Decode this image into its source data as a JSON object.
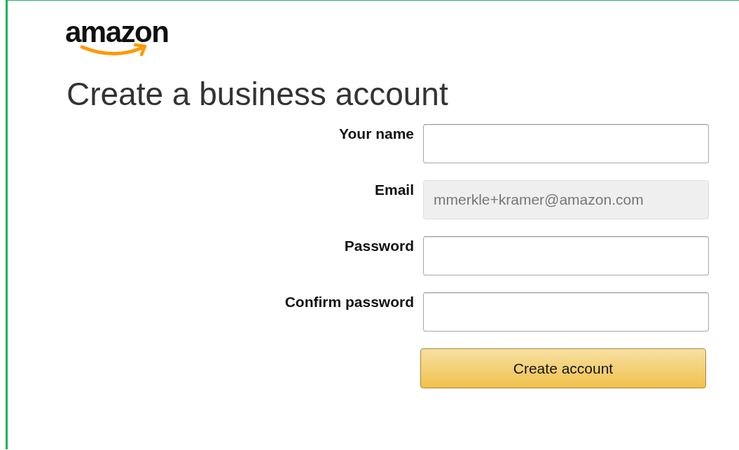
{
  "logo": {
    "text": "amazon"
  },
  "heading": "Create a business account",
  "fields": [
    {
      "label": "Your name",
      "disabled": false
    },
    {
      "label": "Email",
      "value": "mmerkle+kramer@amazon.com",
      "disabled": true
    },
    {
      "label": "Password",
      "disabled": false
    },
    {
      "label": "Confirm password",
      "disabled": false
    }
  ],
  "button": "Create account"
}
